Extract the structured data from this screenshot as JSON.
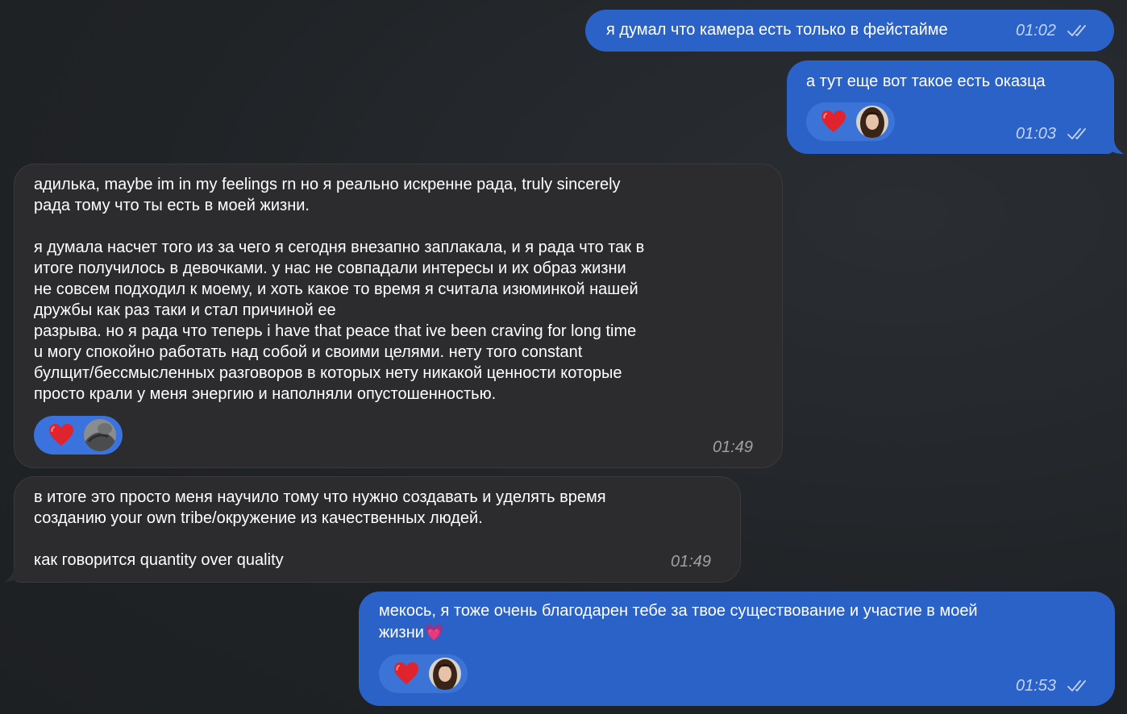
{
  "colors": {
    "background": "#202326",
    "outgoing_bubble": "#2a62c8",
    "incoming_bubble": "#2c2c2e",
    "reaction_heart": "#e0242e"
  },
  "messages": [
    {
      "direction": "outgoing",
      "text": "я думал что камера есть только в фейстайме",
      "time": "01:02",
      "status": "read-double-check",
      "reaction": null
    },
    {
      "direction": "outgoing",
      "text": "а тут еще вот такое есть оказца",
      "time": "01:03",
      "status": "read-double-check",
      "reaction": {
        "emoji": "heart-icon",
        "avatar": "user-avatar-girl"
      }
    },
    {
      "direction": "incoming",
      "text": "адилька, maybe im in my feelings rn но я реально искренне рада, truly sincerely\nрада тому что ты есть в моей жизни.\n\nя думала насчет того из за чего я сегодня внезапно заплакала, и я рада что так в\nитоге получилось в девочками. у нас не совпадали интересы и их образ жизни\nне совсем подходил к моему, и хоть какое то время я считала изюминкой нашей\nдружбы как раз таки и стал причиной ее\nразрыва. но я рада что теперь i have that peace that ive been craving for long time\nu могу спокойно работать над собой и своими целями. нету того constant\nбулщит/бессмысленных разговоров в которых нету никакой ценности которые\nпросто крали у меня энергию и наполняли опустошенностью.",
      "time": "01:49",
      "reaction": {
        "emoji": "heart-icon",
        "avatar": "user-avatar-cat"
      }
    },
    {
      "direction": "incoming",
      "text": "в итоге это просто меня научило тому что нужно создавать и уделять время\nсозданию your own tribe/окружение из качественных людей.\n\nкак говорится quantity over quality",
      "time": "01:49",
      "reaction": null
    },
    {
      "direction": "outgoing",
      "text": "мекось, я тоже очень благодарен тебе за твое существование и участие в моей\nжизни",
      "emoji_after": "💗",
      "time": "01:53",
      "status": "read-double-check",
      "reaction": {
        "emoji": "heart-icon",
        "avatar": "user-avatar-girl"
      }
    }
  ]
}
